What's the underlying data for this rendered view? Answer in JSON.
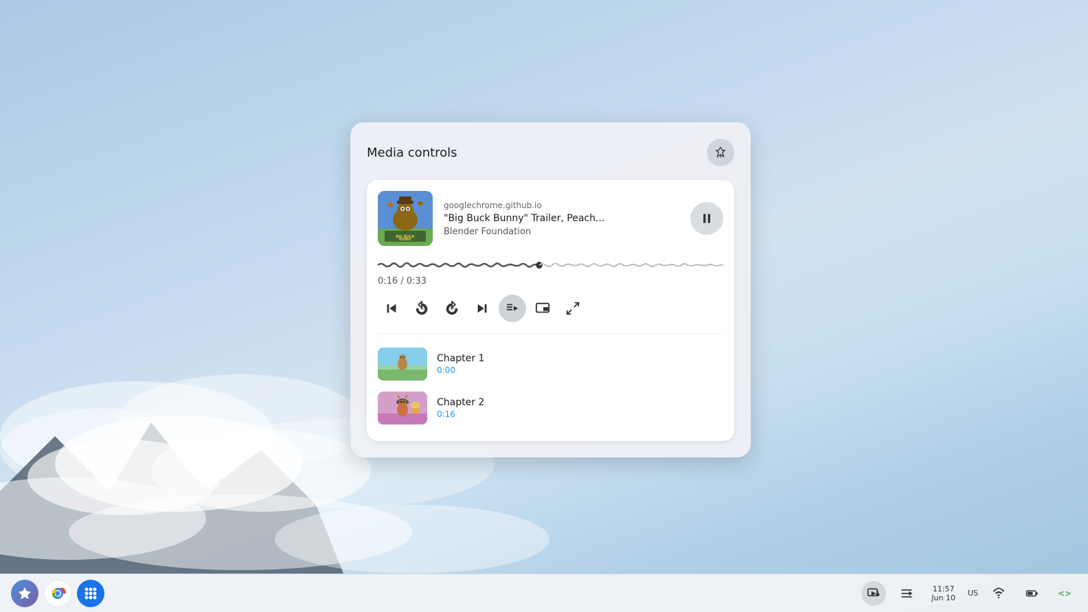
{
  "desktop": {
    "background_colors": [
      "#aec8e8",
      "#b8d4e8",
      "#c5daf0",
      "#d0e2f0"
    ]
  },
  "media_controls": {
    "title": "Media controls",
    "pin_button_label": "Pin",
    "source_url": "googlechrome.github.io",
    "media_title": "\"Big Buck Bunny\" Trailer, Peach...",
    "media_artist": "Blender Foundation",
    "time_current": "0:16",
    "time_total": "0:33",
    "time_display": "0:16 / 0:33",
    "progress_percent": 48,
    "controls": {
      "skip_to_start": "⏮",
      "rewind_10": "↺",
      "forward_10": "↻",
      "next": "⏭",
      "playlist": "playlist",
      "pip": "pip",
      "fullscreen": "fullscreen"
    },
    "chapters": [
      {
        "name": "Chapter 1",
        "time": "0:00",
        "thumb_type": "meadow"
      },
      {
        "name": "Chapter 2",
        "time": "0:16",
        "thumb_type": "squirrel"
      }
    ]
  },
  "taskbar": {
    "date": "Jun 10",
    "time": "11:57",
    "region": "US",
    "apps": [
      {
        "name": "Assistant",
        "icon": "star"
      },
      {
        "name": "Chrome",
        "icon": "chrome"
      },
      {
        "name": "Launcher",
        "icon": "grid"
      }
    ],
    "system_icons": [
      {
        "name": "media-controls",
        "icon": "playlist"
      },
      {
        "name": "notifications",
        "icon": "list"
      },
      {
        "name": "wifi",
        "icon": "wifi"
      },
      {
        "name": "battery",
        "icon": "battery"
      },
      {
        "name": "developer",
        "icon": "code"
      }
    ]
  }
}
